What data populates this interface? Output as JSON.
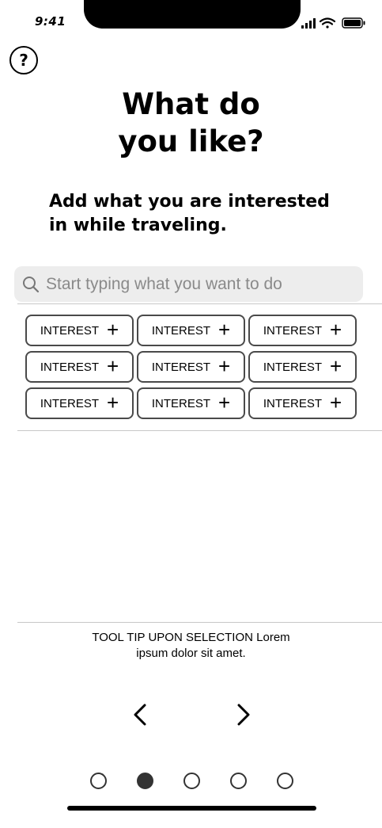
{
  "status": {
    "time": "9:41"
  },
  "header": {
    "help_label": "?"
  },
  "title": {
    "line1": "What do",
    "line2": "you like?"
  },
  "subtitle": {
    "line1": "Add what you are interested",
    "line2": "in while traveling."
  },
  "search": {
    "placeholder": "Start typing what you want to do"
  },
  "interests": [
    {
      "label": "INTEREST"
    },
    {
      "label": "INTEREST"
    },
    {
      "label": "INTEREST"
    },
    {
      "label": "INTEREST"
    },
    {
      "label": "INTEREST"
    },
    {
      "label": "INTEREST"
    },
    {
      "label": "INTEREST"
    },
    {
      "label": "INTEREST"
    },
    {
      "label": "INTEREST"
    }
  ],
  "tooltip": {
    "line1": "TOOL TIP UPON SELECTION Lorem",
    "line2": "ipsum dolor sit amet."
  },
  "pagination": {
    "total": 5,
    "active_index": 1
  },
  "colors": {
    "dot": "#333333",
    "search_bg": "#ededed",
    "chip_border": "#4a4a4a"
  }
}
